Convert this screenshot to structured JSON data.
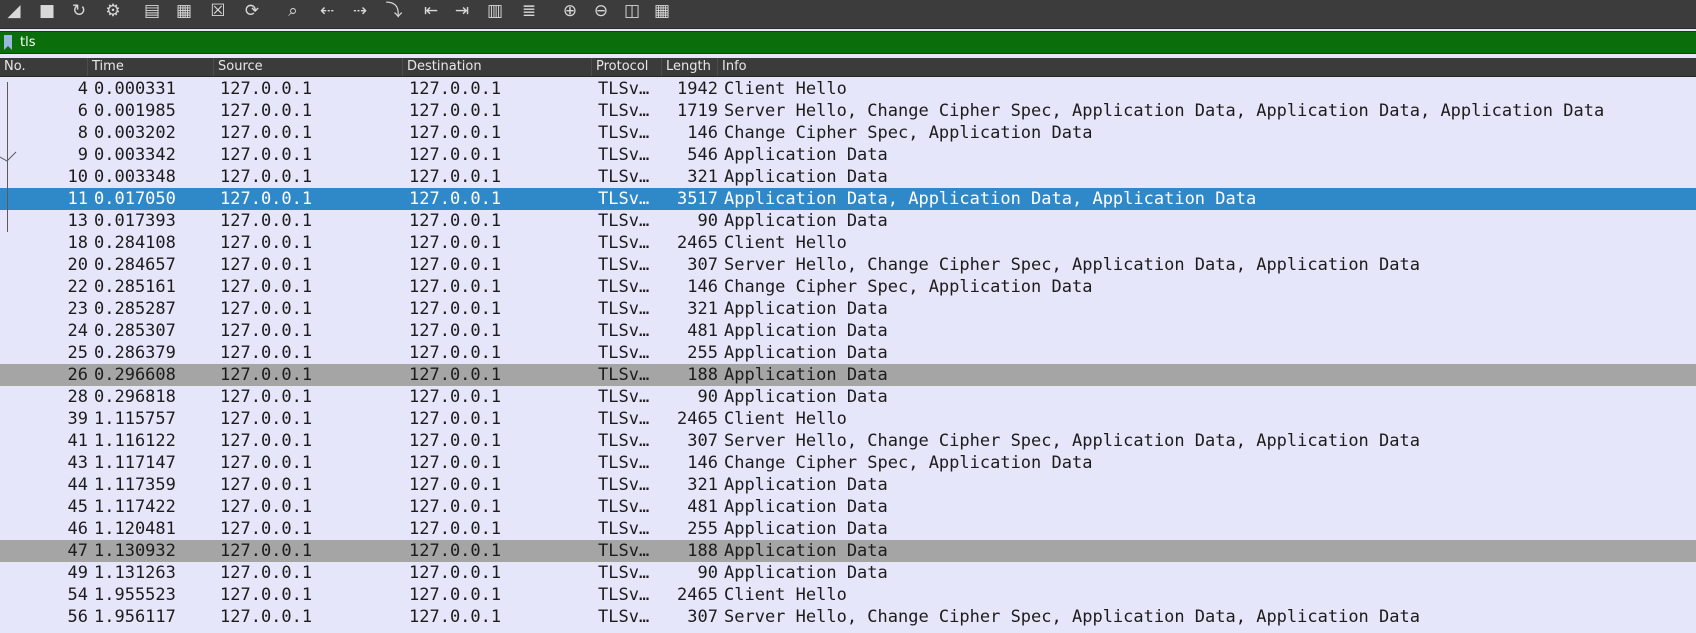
{
  "toolbar": {
    "buttons": [
      {
        "name": "start-capture-icon",
        "glyph": "◢"
      },
      {
        "name": "stop-capture-icon",
        "glyph": "■"
      },
      {
        "name": "restart-capture-icon",
        "glyph": "↻"
      },
      {
        "name": "capture-options-icon",
        "glyph": "⚙"
      },
      {
        "name": "open-file-icon",
        "glyph": "▤"
      },
      {
        "name": "save-file-icon",
        "glyph": "▦"
      },
      {
        "name": "close-file-icon",
        "glyph": "☒"
      },
      {
        "name": "reload-file-icon",
        "glyph": "⟳"
      },
      {
        "name": "find-packet-icon",
        "glyph": "⌕"
      },
      {
        "name": "go-back-icon",
        "glyph": "⇠"
      },
      {
        "name": "go-forward-icon",
        "glyph": "⇢"
      },
      {
        "name": "go-to-packet-icon",
        "glyph": "⤵"
      },
      {
        "name": "go-first-packet-icon",
        "glyph": "⇤"
      },
      {
        "name": "go-last-packet-icon",
        "glyph": "⇥"
      },
      {
        "name": "autoscroll-icon",
        "glyph": "▥"
      },
      {
        "name": "colorize-icon",
        "glyph": "≣"
      },
      {
        "name": "zoom-in-icon",
        "glyph": "⊕"
      },
      {
        "name": "zoom-out-icon",
        "glyph": "⊖"
      },
      {
        "name": "normal-size-icon",
        "glyph": "◫"
      },
      {
        "name": "resize-columns-icon",
        "glyph": "▦"
      }
    ]
  },
  "filter": {
    "value": "tls",
    "colors": {
      "background": "#0a6e0a",
      "bookmark": "#9ab8e0"
    }
  },
  "columns": {
    "no": "No.",
    "time": "Time",
    "source": "Source",
    "destination": "Destination",
    "protocol": "Protocol",
    "length": "Length",
    "info": "Info"
  },
  "colors": {
    "row_default": "#e6e6fa",
    "row_selected": "#2f88c8",
    "row_gray": "#a5a5a5"
  },
  "packets": [
    {
      "no": "4",
      "time": "0.000331",
      "source": "127.0.0.1",
      "destination": "127.0.0.1",
      "protocol": "TLSv…",
      "length": "1942",
      "info": "Client Hello",
      "style": "normal"
    },
    {
      "no": "6",
      "time": "0.001985",
      "source": "127.0.0.1",
      "destination": "127.0.0.1",
      "protocol": "TLSv…",
      "length": "1719",
      "info": "Server Hello, Change Cipher Spec, Application Data, Application Data, Application Data",
      "style": "normal"
    },
    {
      "no": "8",
      "time": "0.003202",
      "source": "127.0.0.1",
      "destination": "127.0.0.1",
      "protocol": "TLSv…",
      "length": "146",
      "info": "Change Cipher Spec, Application Data",
      "style": "normal"
    },
    {
      "no": "9",
      "time": "0.003342",
      "source": "127.0.0.1",
      "destination": "127.0.0.1",
      "protocol": "TLSv…",
      "length": "546",
      "info": "Application Data",
      "style": "normal"
    },
    {
      "no": "10",
      "time": "0.003348",
      "source": "127.0.0.1",
      "destination": "127.0.0.1",
      "protocol": "TLSv…",
      "length": "321",
      "info": "Application Data",
      "style": "normal"
    },
    {
      "no": "11",
      "time": "0.017050",
      "source": "127.0.0.1",
      "destination": "127.0.0.1",
      "protocol": "TLSv…",
      "length": "3517",
      "info": "Application Data, Application Data, Application Data",
      "style": "selected"
    },
    {
      "no": "13",
      "time": "0.017393",
      "source": "127.0.0.1",
      "destination": "127.0.0.1",
      "protocol": "TLSv…",
      "length": "90",
      "info": "Application Data",
      "style": "normal"
    },
    {
      "no": "18",
      "time": "0.284108",
      "source": "127.0.0.1",
      "destination": "127.0.0.1",
      "protocol": "TLSv…",
      "length": "2465",
      "info": "Client Hello",
      "style": "normal"
    },
    {
      "no": "20",
      "time": "0.284657",
      "source": "127.0.0.1",
      "destination": "127.0.0.1",
      "protocol": "TLSv…",
      "length": "307",
      "info": "Server Hello, Change Cipher Spec, Application Data, Application Data",
      "style": "normal"
    },
    {
      "no": "22",
      "time": "0.285161",
      "source": "127.0.0.1",
      "destination": "127.0.0.1",
      "protocol": "TLSv…",
      "length": "146",
      "info": "Change Cipher Spec, Application Data",
      "style": "normal"
    },
    {
      "no": "23",
      "time": "0.285287",
      "source": "127.0.0.1",
      "destination": "127.0.0.1",
      "protocol": "TLSv…",
      "length": "321",
      "info": "Application Data",
      "style": "normal"
    },
    {
      "no": "24",
      "time": "0.285307",
      "source": "127.0.0.1",
      "destination": "127.0.0.1",
      "protocol": "TLSv…",
      "length": "481",
      "info": "Application Data",
      "style": "normal"
    },
    {
      "no": "25",
      "time": "0.286379",
      "source": "127.0.0.1",
      "destination": "127.0.0.1",
      "protocol": "TLSv…",
      "length": "255",
      "info": "Application Data",
      "style": "normal"
    },
    {
      "no": "26",
      "time": "0.296608",
      "source": "127.0.0.1",
      "destination": "127.0.0.1",
      "protocol": "TLSv…",
      "length": "188",
      "info": "Application Data",
      "style": "gray"
    },
    {
      "no": "28",
      "time": "0.296818",
      "source": "127.0.0.1",
      "destination": "127.0.0.1",
      "protocol": "TLSv…",
      "length": "90",
      "info": "Application Data",
      "style": "normal"
    },
    {
      "no": "39",
      "time": "1.115757",
      "source": "127.0.0.1",
      "destination": "127.0.0.1",
      "protocol": "TLSv…",
      "length": "2465",
      "info": "Client Hello",
      "style": "normal"
    },
    {
      "no": "41",
      "time": "1.116122",
      "source": "127.0.0.1",
      "destination": "127.0.0.1",
      "protocol": "TLSv…",
      "length": "307",
      "info": "Server Hello, Change Cipher Spec, Application Data, Application Data",
      "style": "normal"
    },
    {
      "no": "43",
      "time": "1.117147",
      "source": "127.0.0.1",
      "destination": "127.0.0.1",
      "protocol": "TLSv…",
      "length": "146",
      "info": "Change Cipher Spec, Application Data",
      "style": "normal"
    },
    {
      "no": "44",
      "time": "1.117359",
      "source": "127.0.0.1",
      "destination": "127.0.0.1",
      "protocol": "TLSv…",
      "length": "321",
      "info": "Application Data",
      "style": "normal"
    },
    {
      "no": "45",
      "time": "1.117422",
      "source": "127.0.0.1",
      "destination": "127.0.0.1",
      "protocol": "TLSv…",
      "length": "481",
      "info": "Application Data",
      "style": "normal"
    },
    {
      "no": "46",
      "time": "1.120481",
      "source": "127.0.0.1",
      "destination": "127.0.0.1",
      "protocol": "TLSv…",
      "length": "255",
      "info": "Application Data",
      "style": "normal"
    },
    {
      "no": "47",
      "time": "1.130932",
      "source": "127.0.0.1",
      "destination": "127.0.0.1",
      "protocol": "TLSv…",
      "length": "188",
      "info": "Application Data",
      "style": "gray"
    },
    {
      "no": "49",
      "time": "1.131263",
      "source": "127.0.0.1",
      "destination": "127.0.0.1",
      "protocol": "TLSv…",
      "length": "90",
      "info": "Application Data",
      "style": "normal"
    },
    {
      "no": "54",
      "time": "1.955523",
      "source": "127.0.0.1",
      "destination": "127.0.0.1",
      "protocol": "TLSv…",
      "length": "2465",
      "info": "Client Hello",
      "style": "normal"
    },
    {
      "no": "56",
      "time": "1.956117",
      "source": "127.0.0.1",
      "destination": "127.0.0.1",
      "protocol": "TLSv…",
      "length": "307",
      "info": "Server Hello, Change Cipher Spec, Application Data, Application Data",
      "style": "normal"
    }
  ]
}
